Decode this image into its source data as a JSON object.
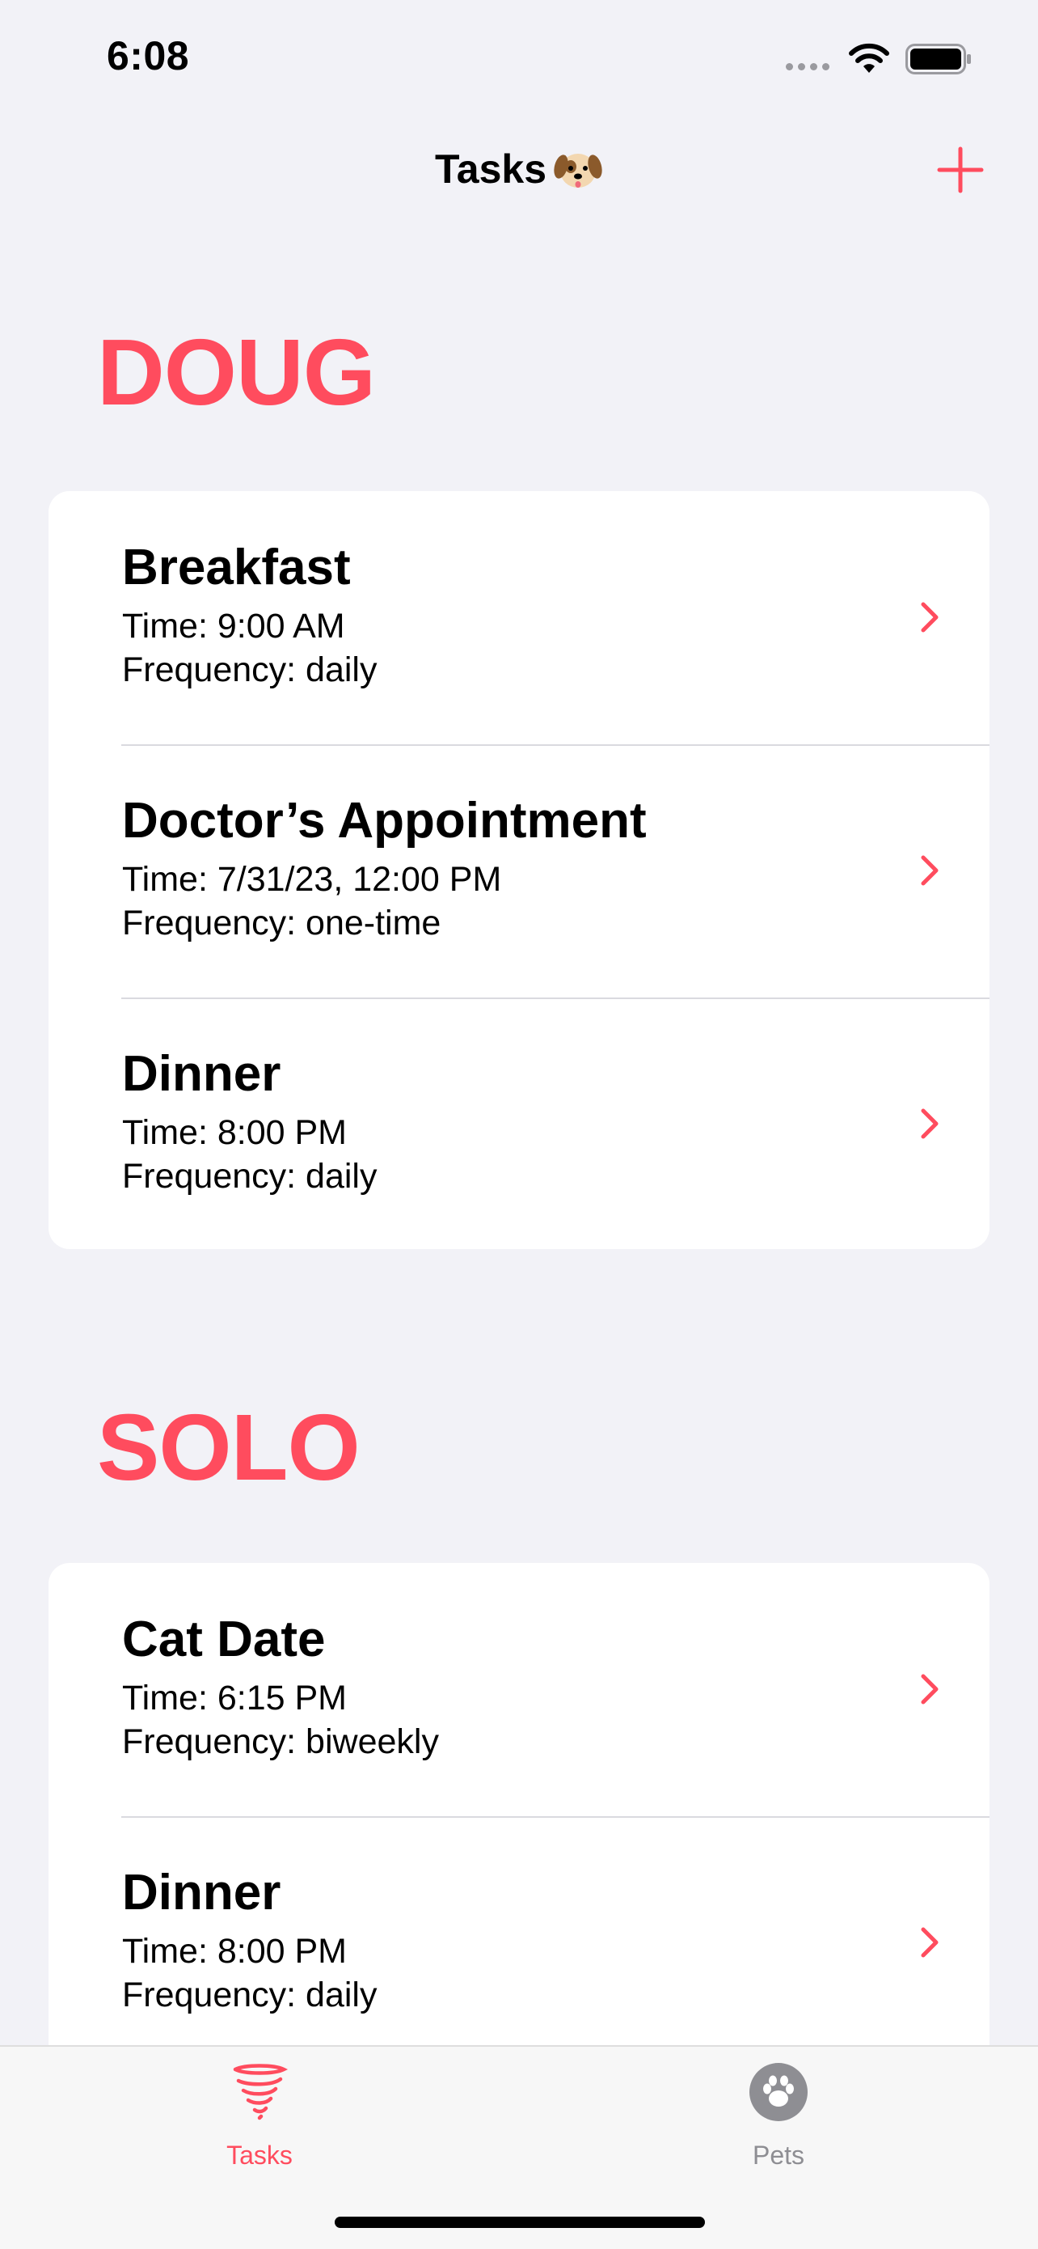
{
  "status_bar": {
    "time": "6:08"
  },
  "nav": {
    "title": "Tasks",
    "emoji_icon": "dog-face-icon",
    "add_icon": "plus-icon"
  },
  "colors": {
    "accent": "#FF4C5E",
    "background": "#F2F2F7",
    "card": "#FFFFFF"
  },
  "sections": [
    {
      "name": "DOUG",
      "tasks": [
        {
          "title": "Breakfast",
          "time": "Time: 9:00 AM",
          "frequency": "Frequency: daily"
        },
        {
          "title": "Doctor’s Appointment",
          "time": "Time: 7/31/23, 12:00 PM",
          "frequency": "Frequency: one-time"
        },
        {
          "title": "Dinner",
          "time": "Time: 8:00 PM",
          "frequency": "Frequency: daily"
        }
      ]
    },
    {
      "name": "SOLO",
      "tasks": [
        {
          "title": "Cat Date",
          "time": "Time: 6:15 PM",
          "frequency": "Frequency: biweekly"
        },
        {
          "title": "Dinner",
          "time": "Time: 8:00 PM",
          "frequency": "Frequency: daily"
        }
      ]
    }
  ],
  "tabbar": {
    "tabs": [
      {
        "label": "Tasks",
        "icon": "tornado-icon",
        "selected": true
      },
      {
        "label": "Pets",
        "icon": "paw-icon",
        "selected": false
      }
    ]
  }
}
